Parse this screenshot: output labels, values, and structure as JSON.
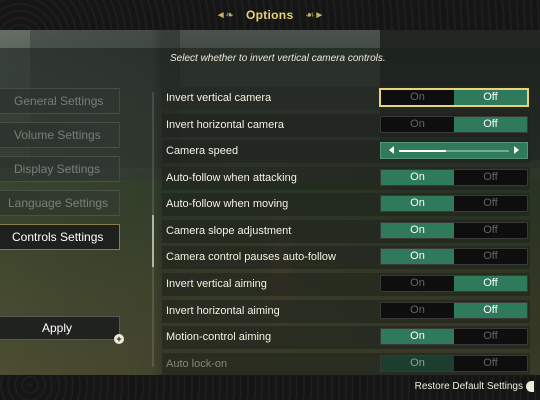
{
  "header": {
    "title": "Options"
  },
  "menu": {
    "items": [
      {
        "label": "General Settings",
        "active": false
      },
      {
        "label": "Volume Settings",
        "active": false
      },
      {
        "label": "Display Settings",
        "active": false
      },
      {
        "label": "Language Settings",
        "active": false
      },
      {
        "label": "Controls Settings",
        "active": true
      }
    ],
    "apply_label": "Apply"
  },
  "description": "Select whether to invert vertical camera controls.",
  "settings": [
    {
      "label": "Invert vertical camera",
      "type": "toggle",
      "options": [
        "On",
        "Off"
      ],
      "selected": "Off",
      "focused": true
    },
    {
      "label": "Invert horizontal camera",
      "type": "toggle",
      "options": [
        "On",
        "Off"
      ],
      "selected": "Off"
    },
    {
      "label": "Camera speed",
      "type": "slider",
      "level": 0.42
    },
    {
      "label": "Auto-follow when attacking",
      "type": "toggle",
      "options": [
        "On",
        "Off"
      ],
      "selected": "On"
    },
    {
      "label": "Auto-follow when moving",
      "type": "toggle",
      "options": [
        "On",
        "Off"
      ],
      "selected": "On"
    },
    {
      "label": "Camera slope adjustment",
      "type": "toggle",
      "options": [
        "On",
        "Off"
      ],
      "selected": "On"
    },
    {
      "label": "Camera control pauses auto-follow",
      "type": "toggle",
      "options": [
        "On",
        "Off"
      ],
      "selected": "On"
    },
    {
      "label": "Invert vertical aiming",
      "type": "toggle",
      "options": [
        "On",
        "Off"
      ],
      "selected": "Off"
    },
    {
      "label": "Invert horizontal aiming",
      "type": "toggle",
      "options": [
        "On",
        "Off"
      ],
      "selected": "Off"
    },
    {
      "label": "Motion-control aiming",
      "type": "toggle",
      "options": [
        "On",
        "Off"
      ],
      "selected": "On"
    },
    {
      "label": "Auto lock-on",
      "type": "toggle",
      "options": [
        "On",
        "Off"
      ],
      "selected": "On",
      "faded": true
    }
  ],
  "footer": {
    "restore_label": "Restore Default Settings"
  },
  "colors": {
    "accent": "#e9d27a",
    "selected": "#2f7a5a",
    "panel": "#141514"
  }
}
